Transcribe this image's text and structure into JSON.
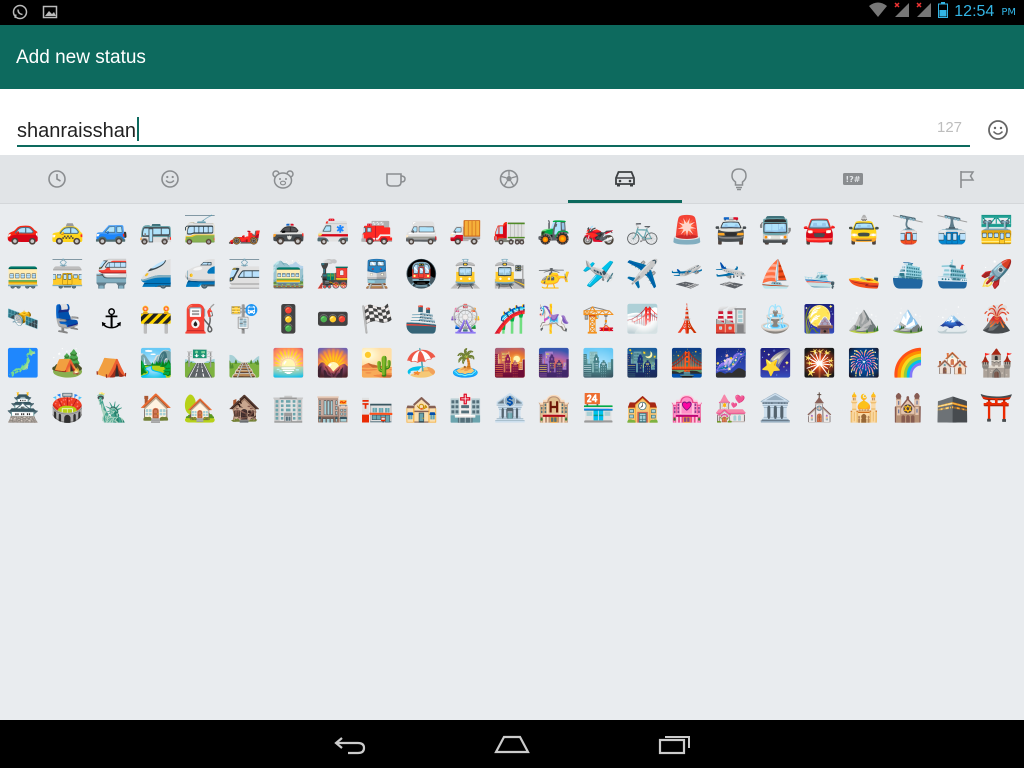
{
  "status_bar": {
    "time": "12:54",
    "ampm": "PM",
    "notification_icons": [
      "whatsapp-icon",
      "image-icon"
    ],
    "system_icons": [
      "wifi-icon",
      "signal-icon",
      "signal-icon",
      "battery-icon"
    ]
  },
  "app_bar": {
    "title": "Add new status"
  },
  "status_input": {
    "value": "shanraisshan",
    "counter": "127"
  },
  "tabs": [
    {
      "name": "tab-recent",
      "icon": "clock-icon"
    },
    {
      "name": "tab-smileys",
      "icon": "smiley-icon"
    },
    {
      "name": "tab-animals",
      "icon": "bear-icon"
    },
    {
      "name": "tab-food",
      "icon": "cup-icon"
    },
    {
      "name": "tab-activities",
      "icon": "soccer-ball-icon"
    },
    {
      "name": "tab-travel",
      "icon": "car-icon",
      "active": true
    },
    {
      "name": "tab-objects",
      "icon": "lightbulb-icon"
    },
    {
      "name": "tab-symbols",
      "icon": "symbols-icon"
    },
    {
      "name": "tab-flags",
      "icon": "flag-icon"
    }
  ],
  "emoji_rows": [
    [
      "🚗",
      "🚕",
      "🚙",
      "🚌",
      "🚎",
      "🏎️",
      "🚓",
      "🚑",
      "🚒",
      "🚐",
      "🚚",
      "🚛",
      "🚜",
      "🏍️",
      "🚲",
      "🚨",
      "🚔",
      "🚍",
      "🚘",
      "🚖",
      "🚡",
      "🚠",
      "🚟"
    ],
    [
      "🚃",
      "🚋",
      "🚝",
      "🚄",
      "🚅",
      "🚈",
      "🚞",
      "🚂",
      "🚆",
      "🚇",
      "🚊",
      "🚉",
      "🚁",
      "🛩️",
      "✈️",
      "🛫",
      "🛬",
      "⛵",
      "🛥️",
      "🚤",
      "⛴️",
      "🛳️",
      "🚀"
    ],
    [
      "🛰️",
      "💺",
      "⚓",
      "🚧",
      "⛽",
      "🚏",
      "🚦",
      "🚥",
      "🏁",
      "🚢",
      "🎡",
      "🎢",
      "🎠",
      "🏗️",
      "🌁",
      "🗼",
      "🏭",
      "⛲",
      "🎑",
      "⛰️",
      "🏔️",
      "🗻",
      "🌋"
    ],
    [
      "🗾",
      "🏕️",
      "⛺",
      "🏞️",
      "🛣️",
      "🛤️",
      "🌅",
      "🌄",
      "🏜️",
      "🏖️",
      "🏝️",
      "🌇",
      "🌆",
      "🏙️",
      "🌃",
      "🌉",
      "🌌",
      "🌠",
      "🎇",
      "🎆",
      "🌈",
      "🏘️",
      "🏰"
    ],
    [
      "🏯",
      "🏟️",
      "🗽",
      "🏠",
      "🏡",
      "🏚️",
      "🏢",
      "🏬",
      "🏣",
      "🏤",
      "🏥",
      "🏦",
      "🏨",
      "🏪",
      "🏫",
      "🏩",
      "💒",
      "🏛️",
      "⛪",
      "🕌",
      "🕍",
      "🕋",
      "⛩️"
    ]
  ],
  "colors": {
    "primary": "#0d6a5e",
    "keyboard_bg": "#e9ecef",
    "tab_bg": "#e1e4e7",
    "status_blue": "#33b5e5"
  },
  "nav_bar": {
    "icons": [
      "back-icon",
      "home-icon",
      "recents-icon"
    ]
  }
}
